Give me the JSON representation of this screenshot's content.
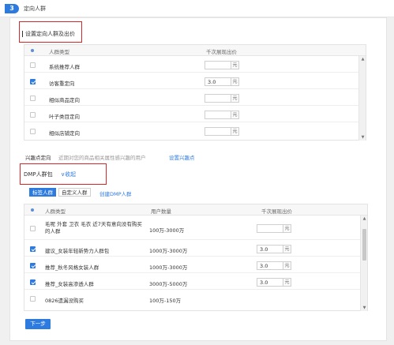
{
  "header": {
    "step_number": "3",
    "section_title": "定向人群"
  },
  "targeting": {
    "subtitle": "设置定向人群及出价",
    "columns": [
      "人群类型",
      "千次展现出价"
    ],
    "rows": [
      {
        "name": "系统推荐人群",
        "checked": false,
        "price": ""
      },
      {
        "name": "访客重定向",
        "checked": true,
        "price": "3.0"
      },
      {
        "name": "相似商品定向",
        "checked": false,
        "price": ""
      },
      {
        "name": "叶子类目定向",
        "checked": false,
        "price": ""
      },
      {
        "name": "相似店铺定向",
        "checked": false,
        "price": ""
      }
    ],
    "price_unit": "元"
  },
  "interest": {
    "label": "兴趣点定向",
    "description": "近期对您的商品相关属性感兴趣的用户",
    "link": "设置兴趣点"
  },
  "dmp": {
    "title": "DMP人群包",
    "collapse_label": "∨收起",
    "tabs": [
      "标签人群",
      "自定义人群"
    ],
    "create_link": "创建DMP人群",
    "columns": [
      "人群类型",
      "用户数量",
      "千次展现出价"
    ],
    "rows": [
      {
        "name": "毛呢 外套 卫衣 毛衣 近7天有意向没有购买的人群",
        "count": "100万-3000万",
        "checked": false,
        "price": ""
      },
      {
        "name": "建议_女装年轻新势力人群包",
        "count": "1000万-3000万",
        "checked": true,
        "price": "3.0"
      },
      {
        "name": "推荐_秋冬风格女装人群",
        "count": "1000万-3000万",
        "checked": true,
        "price": "3.0"
      },
      {
        "name": "推荐_女装高渗透人群",
        "count": "3000万-5000万",
        "checked": true,
        "price": "3.0"
      },
      {
        "name": "0826遗漏没购买",
        "count": "100万-150万",
        "checked": false,
        "price": ""
      }
    ],
    "price_unit": "元"
  },
  "next_button": "下一步",
  "colors": {
    "primary": "#2e7be0",
    "highlight": "#d8272b"
  }
}
